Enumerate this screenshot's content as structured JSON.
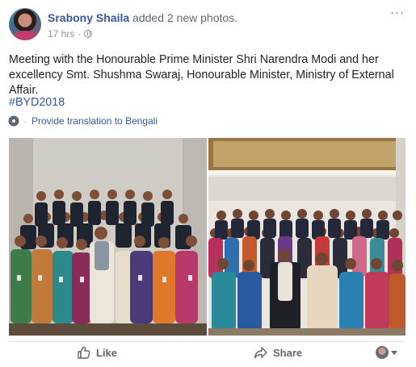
{
  "post": {
    "author": "Srabony Shaila",
    "action": "added 2 new photos.",
    "timestamp": "17 hrs",
    "meta_separator": "·",
    "text": "Meeting with the Honourable Prime Minister Shri Narendra Modi and her excellency Smt. Shushma Swaraj, Honourable Minister, Ministry of External Affair.",
    "hashtag": "#BYD2018",
    "translate_link": "Provide translation to Bengali",
    "icons": {
      "privacy": "globe-icon",
      "menu": "more-options-icon",
      "translate": "gear-icon",
      "like": "thumbs-up-icon",
      "share": "share-arrow-icon"
    }
  },
  "photos": [
    {
      "alt": "group-photo-1"
    },
    {
      "alt": "group-photo-2"
    }
  ],
  "actions": {
    "like_label": "Like",
    "share_label": "Share"
  },
  "colors": {
    "link": "#365899",
    "muted": "#90949c",
    "action_text": "#606770"
  }
}
